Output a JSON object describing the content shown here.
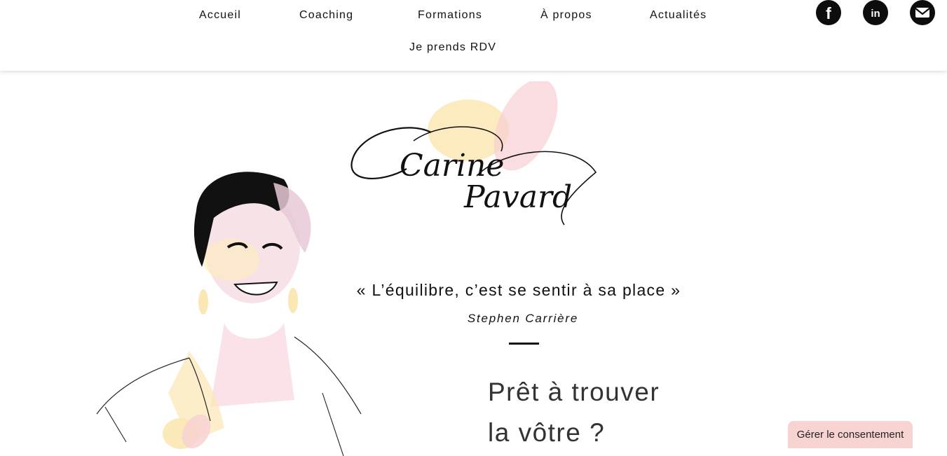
{
  "nav": {
    "items": [
      {
        "label": "Accueil"
      },
      {
        "label": "Coaching"
      },
      {
        "label": "Formations"
      },
      {
        "label": "À propos"
      },
      {
        "label": "Actualités"
      },
      {
        "label": "Je prends RDV"
      }
    ],
    "social": [
      {
        "icon": "facebook-icon",
        "glyph": "f"
      },
      {
        "icon": "linkedin-icon",
        "glyph": "in"
      },
      {
        "icon": "mail-icon"
      }
    ]
  },
  "brand": {
    "logo_first": "Carine",
    "logo_last": "Pavard"
  },
  "hero": {
    "quote": "« L’équilibre, c’est se sentir à sa place »",
    "author": "Stephen Carrière",
    "tagline_line1": "Prêt à trouver",
    "tagline_line2": "la vôtre ?"
  },
  "consent": {
    "label": "Gérer le consentement"
  },
  "colors": {
    "accent_pink": "#f7cccf",
    "accent_yellow": "#fbe7b3",
    "text": "#111111",
    "consent_bg": "#f7d4d2"
  }
}
